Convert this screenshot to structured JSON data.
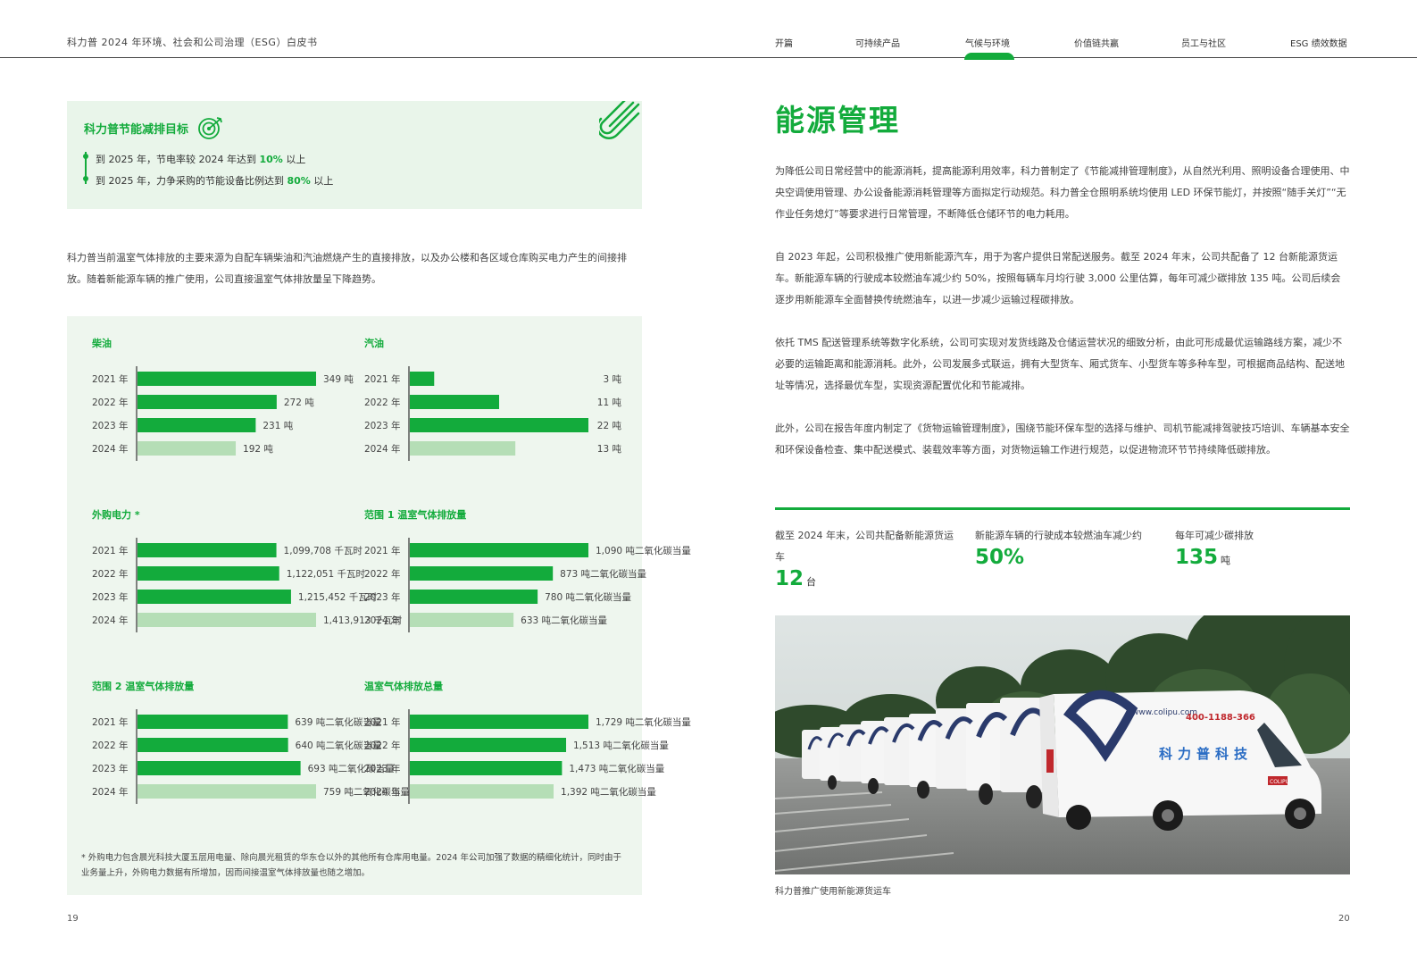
{
  "header": {
    "doc_title": "科力普 2024 年环境、社会和公司治理（ESG）白皮书",
    "nav": [
      {
        "label": "开篇"
      },
      {
        "label": "可持续产品"
      },
      {
        "label": "气候与环境",
        "active": true
      },
      {
        "label": "价值链共赢"
      },
      {
        "label": "员工与社区"
      },
      {
        "label": "ESG 绩效数据"
      }
    ]
  },
  "target_box": {
    "title": "科力普节能减排目标",
    "line1": {
      "pre": "到 2025 年，节电率较 2024 年达到 ",
      "bold": "10%",
      "post": " 以上"
    },
    "line2": {
      "pre": "到 2025 年，力争采购的节能设备比例达到 ",
      "bold": "80%",
      "post": " 以上"
    }
  },
  "intro": "科力普当前温室气体排放的主要来源为自配车辆柴油和汽油燃烧产生的直接排放，以及办公楼和各区域仓库购买电力产生的间接排放。随着新能源车辆的推广使用，公司直接温室气体排放量呈下降趋势。",
  "chart_data": [
    {
      "type": "bar",
      "title": "柴油",
      "categories": [
        "2021 年",
        "2022 年",
        "2023 年",
        "2024 年"
      ],
      "values": [
        349,
        272,
        231,
        192
      ],
      "unit": "吨",
      "labels": [
        "349 吨",
        "272 吨",
        "231 吨",
        "192 吨"
      ],
      "label_align": "end"
    },
    {
      "type": "bar",
      "title": "汽油",
      "categories": [
        "2021 年",
        "2022 年",
        "2023 年",
        "2024 年"
      ],
      "values": [
        3,
        11,
        22,
        13
      ],
      "unit": "吨",
      "labels": [
        "3 吨",
        "11 吨",
        "22 吨",
        "13 吨"
      ],
      "label_align": "right"
    },
    {
      "type": "bar",
      "title": "外购电力 *",
      "categories": [
        "2021 年",
        "2022 年",
        "2023 年",
        "2024 年"
      ],
      "values": [
        1099708,
        1122051,
        1215452,
        1413913
      ],
      "unit": "千瓦时",
      "labels": [
        "1,099,708 千瓦时",
        "1,122,051 千瓦时",
        "1,215,452 千瓦时",
        "1,413,913 千瓦时"
      ],
      "label_align": "end"
    },
    {
      "type": "bar",
      "title": "范围 1 温室气体排放量",
      "categories": [
        "2021 年",
        "2022 年",
        "2023 年",
        "2024 年"
      ],
      "values": [
        1090,
        873,
        780,
        633
      ],
      "unit": "吨二氧化碳当量",
      "labels": [
        "1,090 吨二氧化碳当量",
        "873 吨二氧化碳当量",
        "780 吨二氧化碳当量",
        "633 吨二氧化碳当量"
      ],
      "label_align": "end"
    },
    {
      "type": "bar",
      "title": "范围 2 温室气体排放量",
      "categories": [
        "2021 年",
        "2022 年",
        "2023 年",
        "2024 年"
      ],
      "values": [
        639,
        640,
        693,
        759
      ],
      "unit": "吨二氧化碳当量",
      "labels": [
        "639 吨二氧化碳当量",
        "640 吨二氧化碳当量",
        "693 吨二氧化碳当量",
        "759 吨二氧化碳当量"
      ],
      "label_align": "end"
    },
    {
      "type": "bar",
      "title": "温室气体排放总量",
      "categories": [
        "2021 年",
        "2022 年",
        "2023 年",
        "2024 年"
      ],
      "values": [
        1729,
        1513,
        1473,
        1392
      ],
      "unit": "吨二氧化碳当量",
      "labels": [
        "1,729 吨二氧化碳当量",
        "1,513 吨二氧化碳当量",
        "1,473 吨二氧化碳当量",
        "1,392 吨二氧化碳当量"
      ],
      "label_align": "end"
    }
  ],
  "footnote": "* 外购电力包含晨光科技大厦五层用电量、除向晨光租赁的华东仓以外的其他所有仓库用电量。2024 年公司加强了数据的精细化统计，同时由于业务量上升，外购电力数据有所增加，因而间接温室气体排放量也随之增加。",
  "right": {
    "section_title": "能源管理",
    "para1": "为降低公司日常经营中的能源消耗，提高能源利用效率，科力普制定了《节能减排管理制度》，从自然光利用、照明设备合理使用、中央空调使用管理、办公设备能源消耗管理等方面拟定行动规范。科力普全仓照明系统均使用 LED 环保节能灯，并按照“随手关灯”“无作业任务熄灯”等要求进行日常管理，不断降低仓储环节的电力耗用。",
    "para2": "自 2023 年起，公司积极推广使用新能源汽车，用于为客户提供日常配送服务。截至 2024 年末，公司共配备了 12 台新能源货运车。新能源车辆的行驶成本较燃油车减少约 50%，按照每辆车月均行驶 3,000 公里估算，每年可减少碳排放 135 吨。公司后续会逐步用新能源车全面替换传统燃油车，以进一步减少运输过程碳排放。",
    "para3": "依托 TMS 配送管理系统等数字化系统，公司可实现对发货线路及仓储运营状况的细致分析，由此可形成最优运输路线方案，减少不必要的运输距离和能源消耗。此外，公司发展多式联运，拥有大型货车、厢式货车、小型货车等多种车型，可根据商品结构、配送地址等情况，选择最优车型，实现资源配置优化和节能减排。",
    "para4": "此外，公司在报告年度内制定了《货物运输管理制度》，围绕节能环保车型的选择与维护、司机节能减排驾驶技巧培训、车辆基本安全和环保设备检查、集中配送模式、装载效率等方面，对货物运输工作进行规范，以促进物流环节节持续降低碳排放。",
    "stats": [
      {
        "label": "截至 2024 年末，公司共配备新能源货运车",
        "value": "12",
        "unit": "台"
      },
      {
        "label": "新能源车辆的行驶成本较燃油车减少约",
        "value": "50%",
        "unit": ""
      },
      {
        "label": "每年可减少碳排放",
        "value": "135",
        "unit": "吨"
      }
    ],
    "photo_text": {
      "url": "www.colipu.com",
      "phone": "400-1188-366",
      "brand": "科力普科技",
      "badge": "COLIPU"
    },
    "photo_caption": "科力普推广使用新能源货运车"
  },
  "page_numbers": {
    "left": "19",
    "right": "20"
  },
  "colors": {
    "accent": "#13ab3c",
    "bar": "#13ab3c",
    "bar_latest": "#b5deb6",
    "panel": "#eef6ee",
    "box": "#e9f5ea"
  }
}
